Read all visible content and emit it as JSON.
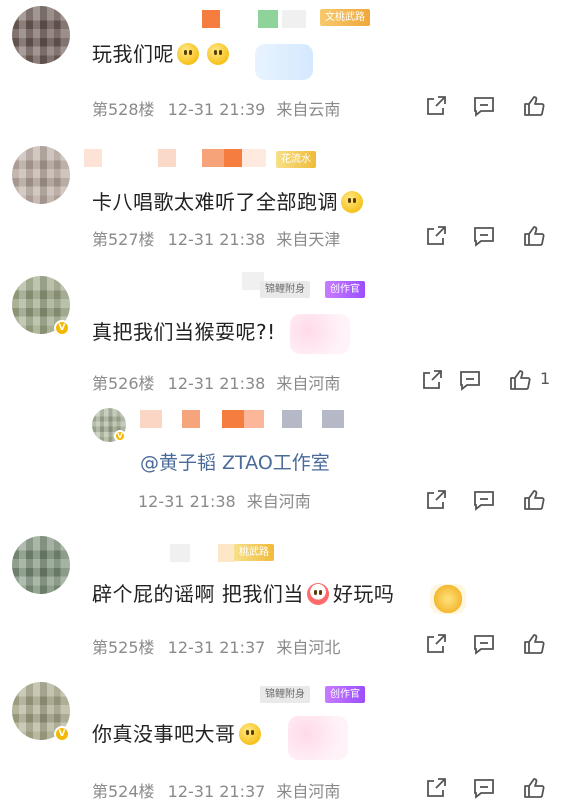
{
  "comments": [
    {
      "tag": "文桃武路",
      "text": "玩我们呢",
      "floor": "第528楼",
      "time": "12-31 21:39",
      "location": "来自云南",
      "like_count": ""
    },
    {
      "tag": "花流水",
      "text": "卡八唱歌太难听了全部跑调",
      "floor": "第527楼",
      "time": "12-31 21:38",
      "location": "来自天津",
      "like_count": ""
    },
    {
      "tag_gray": "锦鲤附身",
      "tag_purple": "创作官",
      "text": "真把我们当猴耍呢?!",
      "floor": "第526楼",
      "time": "12-31 21:38",
      "location": "来自河南",
      "like_count": "1"
    },
    {
      "mention": "@黄子韬 ZTAO工作室",
      "time": "12-31 21:38",
      "location": "来自河南"
    },
    {
      "tag": "桃武路",
      "text_before": "辟个屁的谣啊 把我们当",
      "text_after": "好玩吗",
      "floor": "第525楼",
      "time": "12-31 21:37",
      "location": "来自河北"
    },
    {
      "tag_gray": "锦鲤附身",
      "tag_purple": "创作官",
      "text": "你真没事吧大哥",
      "floor": "第524楼",
      "time": "12-31 21:37",
      "location": "来自河南"
    }
  ],
  "colors": {
    "meta_text": "#8a8a8a",
    "mention": "#4a6a98",
    "verified_badge": "#f5b800",
    "tag_orange": "#f0a73a",
    "tag_purple": "#9b4dff"
  },
  "icons": [
    "share-icon",
    "comment-icon",
    "like-icon",
    "verified-badge-icon",
    "smile-emoji",
    "clown-emoji",
    "thinking-emoji"
  ]
}
